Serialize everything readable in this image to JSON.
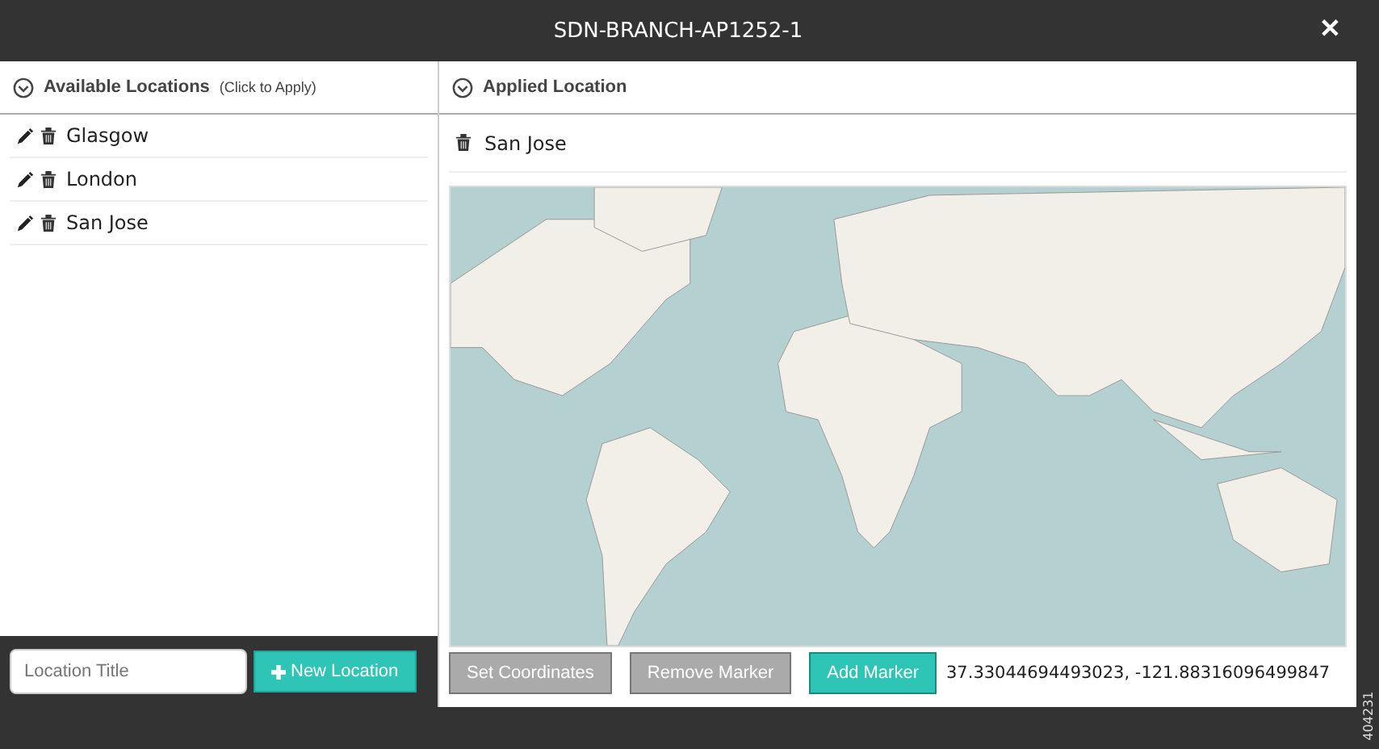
{
  "window": {
    "title": "SDN-BRANCH-AP1252-1",
    "close": "✕"
  },
  "available": {
    "title": "Available Locations",
    "hint": "(Click to Apply)",
    "items": [
      {
        "name": "Glasgow"
      },
      {
        "name": "London"
      },
      {
        "name": "San Jose"
      }
    ]
  },
  "applied": {
    "title": "Applied Location",
    "location": "San Jose"
  },
  "new_location": {
    "placeholder": "Location Title",
    "button": "New Location"
  },
  "map_buttons": [
    {
      "label": "Set Coordinates",
      "kind": "plain"
    },
    {
      "label": "Remove Marker",
      "kind": "plain"
    },
    {
      "label": "Add Marker",
      "kind": "primary"
    }
  ],
  "coordinates": "37.33044694493023, -121.88316096499847",
  "figure_id": "404231"
}
